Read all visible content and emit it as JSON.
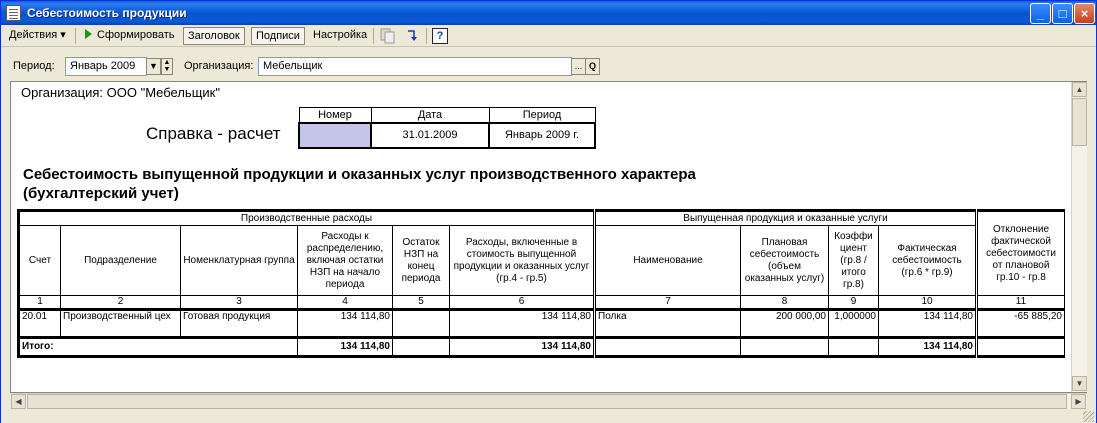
{
  "window": {
    "title": "Себестоимость продукции"
  },
  "toolbar": {
    "actions": "Действия",
    "generate": "Сформировать",
    "header": "Заголовок",
    "signatures": "Подписи",
    "settings": "Настройка",
    "help": "?"
  },
  "params": {
    "period_label": "Период:",
    "period_value": "Январь 2009",
    "org_label": "Организация:",
    "org_value": "Мебельщик",
    "select_btn": "...",
    "search_btn": "Q"
  },
  "report": {
    "organization": "Организация: ООО \"Мебельщик\"",
    "doc_title": "Справка - расчет",
    "header_cols": [
      "Номер",
      "Дата",
      "Период"
    ],
    "header_vals": [
      "",
      "31.01.2009",
      "Январь 2009 г."
    ],
    "title_line1": "Себестоимость выпущенной продукции и оказанных услуг производственного характера",
    "title_line2": "(бухгалтерский учет)",
    "group_left": "Производственные расходы",
    "group_right": "Выпущенная  продукция и оказанные услуги",
    "columns": [
      "Счет",
      "Подразделение",
      "Номенклатурная группа",
      "Расходы к распределению, включая остатки НЗП на начало периода",
      "Остаток НЗП на конец периода",
      "Расходы, включенные в стоимость выпущенной продукции и оказанных услуг (гр.4 - гр.5)",
      "Наименование",
      "Плановая себестоимость (объем оказанных услуг)",
      "Коэффи циент (гр.8 / итого гр.8)",
      "Фактическая себестоимость (гр.6 * гр.9)",
      "Отклонение фактической себестоимости от плановой гр.10 - гр.8"
    ],
    "col_numbers": [
      "1",
      "2",
      "3",
      "4",
      "5",
      "6",
      "7",
      "8",
      "9",
      "10",
      "11"
    ],
    "rows": [
      {
        "account": "20.01",
        "division": "Производственный цех",
        "group": "Готовая продукция",
        "expenses": "134 114,80",
        "wip_end": "",
        "included": "134 114,80",
        "name": "Полка",
        "planned": "200 000,00",
        "coef": "1,000000",
        "actual": "134 114,80",
        "deviation": "-65 885,20"
      }
    ],
    "total": {
      "label": "Итого:",
      "expenses": "134 114,80",
      "included": "134 114,80",
      "actual": "134 114,80"
    }
  },
  "colors": {
    "title_bar": "#0a5ad6",
    "number_cell": "#c5c5e8",
    "play_icon": "#1a9a1a"
  }
}
